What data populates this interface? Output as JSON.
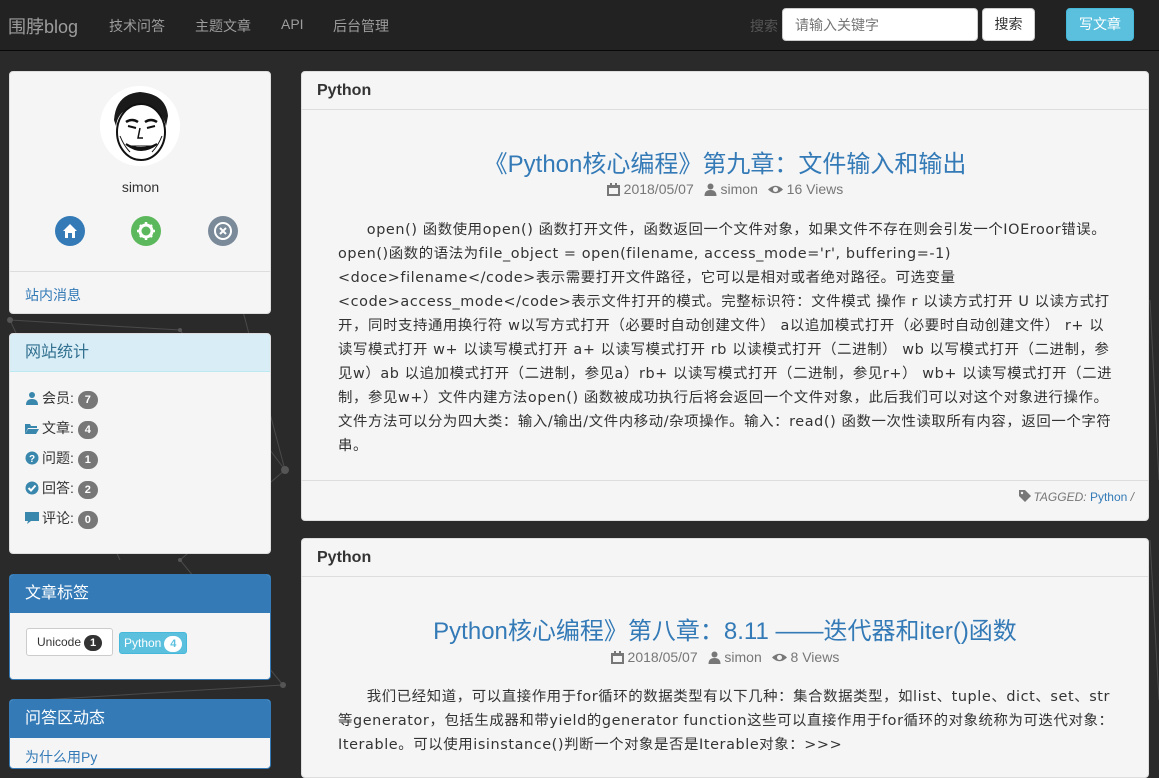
{
  "nav": {
    "brand": "围脖blog",
    "items": [
      "技术问答",
      "主题文章",
      "API",
      "后台管理"
    ],
    "search_ghost": "搜索",
    "search_placeholder": "请输入关键字",
    "search_button": "搜索",
    "write_button": "写文章"
  },
  "profile": {
    "username": "simon",
    "icons": [
      "home-icon",
      "settings-icon",
      "logout-icon"
    ],
    "messages_link": "站内消息"
  },
  "stats": {
    "title": "网站统计",
    "rows": [
      {
        "label": "会员:",
        "count": "7",
        "icon": "user-icon"
      },
      {
        "label": "文章:",
        "count": "4",
        "icon": "folder-open-icon"
      },
      {
        "label": "问题:",
        "count": "1",
        "icon": "question-icon"
      },
      {
        "label": "回答:",
        "count": "2",
        "icon": "check-circle-icon"
      },
      {
        "label": "评论:",
        "count": "0",
        "icon": "comment-icon"
      }
    ]
  },
  "tags": {
    "title": "文章标签",
    "items": [
      {
        "label": "Unicode",
        "count": "1"
      },
      {
        "label": "Python",
        "count": "4"
      }
    ]
  },
  "qa": {
    "title": "问答区动态",
    "partial_text": "为什么用Py"
  },
  "articles": [
    {
      "category": "Python",
      "title": "《Python核心编程》第九章：文件输入和输出",
      "date": "2018/05/07",
      "author": "simon",
      "views": "16 Views",
      "body": "open() 函数使用open() 函数打开文件，函数返回一个文件对象，如果文件不存在则会引发一个IOEroor错误。open()函数的语法为file_object = open(filename, access_mode='r', buffering=-1)<doce>filename</code>表示需要打开文件路径，它可以是相对或者绝对路径。可选变量<code>access_mode</code>表示文件打开的模式。完整标识符：文件模式 操作 r 以读方式打开 U 以读方式打开，同时支持通用换行符 w以写方式打开（必要时自动创建文件） a以追加模式打开（必要时自动创建文件） r+ 以读写模式打开 w+ 以读写模式打开 a+ 以读写模式打开 rb 以读模式打开（二进制） wb 以写模式打开（二进制，参见w）ab 以追加模式打开（二进制，参见a）rb+ 以读写模式打开（二进制，参见r+） wb+ 以读写模式打开（二进制，参见w+）文件内建方法open() 函数被成功执行后将会返回一个文件对象，此后我们可以对这个对象进行操作。文件方法可以分为四大类：输入/输出/文件内移动/杂项操作。输入：read() 函数一次性读取所有内容，返回一个字符串。",
      "tagged_label": "TAGGED:",
      "tag": "Python",
      "tag_sep": "/"
    },
    {
      "category": "Python",
      "title": "Python核心编程》第八章：8.11 ——迭代器和iter()函数",
      "date": "2018/05/07",
      "author": "simon",
      "views": "8 Views",
      "body": "我们已经知道，可以直接作用于for循环的数据类型有以下几种：集合数据类型，如list、tuple、dict、set、str等generator，包括生成器和带yield的generator function这些可以直接作用于for循环的对象统称为可迭代对象：Iterable。可以使用isinstance()判断一个对象是否是Iterable对象：>>>"
    }
  ],
  "colors": {
    "link": "#337ab7",
    "info": "#5bc0de",
    "primary": "#337ab7",
    "navbar": "#222222"
  }
}
